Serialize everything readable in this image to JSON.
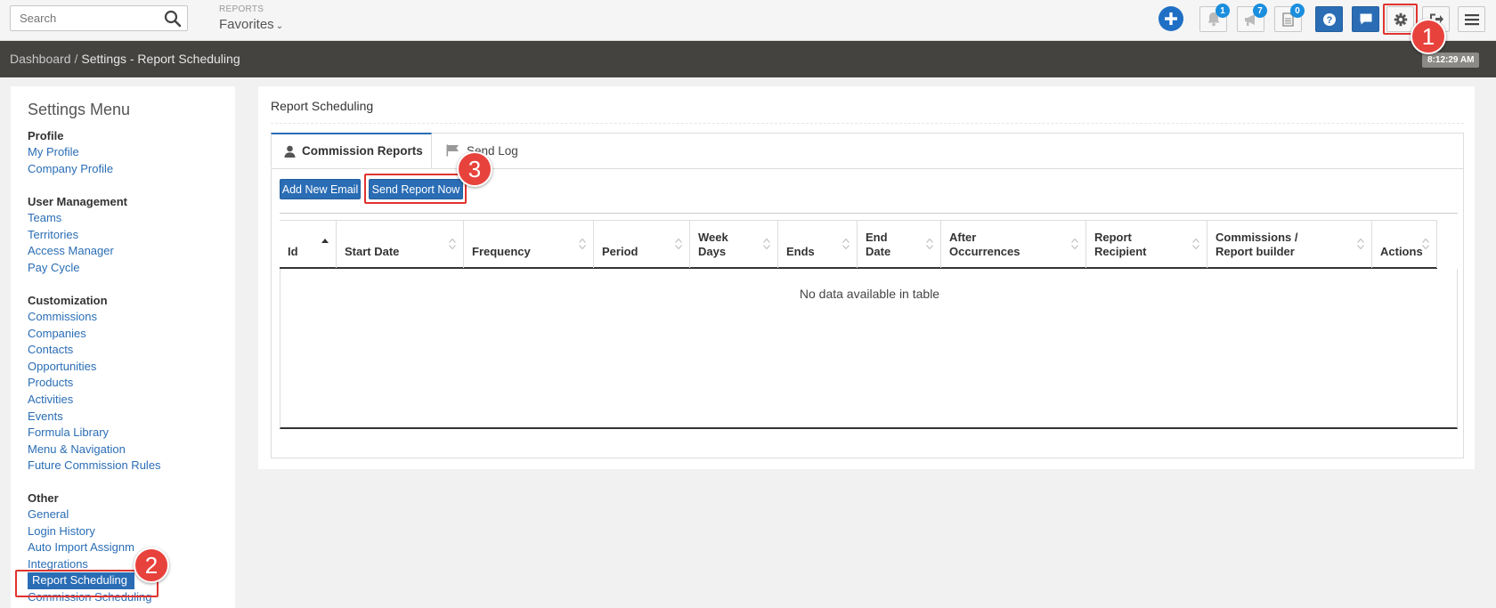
{
  "topbar": {
    "search_placeholder": "Search",
    "reports_label": "REPORTS",
    "favorites_label": "Favorites",
    "notifications_count": "1",
    "announcements_count": "7",
    "documents_count": "0",
    "help_icon": "question-icon",
    "chat_icon": "chat-icon",
    "settings_icon": "gear-icon",
    "logout_icon": "logout-icon",
    "menu_icon": "hamburger-icon"
  },
  "breadcrumb": {
    "home": "Dashboard",
    "separator": "/",
    "current": "Settings - Report Scheduling",
    "clock": "8:12:29 AM"
  },
  "sidebar": {
    "title": "Settings Menu",
    "sections": [
      {
        "heading": "Profile",
        "items": [
          "My Profile",
          "Company Profile"
        ]
      },
      {
        "heading": "User Management",
        "items": [
          "Teams",
          "Territories",
          "Access Manager",
          "Pay Cycle"
        ]
      },
      {
        "heading": "Customization",
        "items": [
          "Commissions",
          "Companies",
          "Contacts",
          "Opportunities",
          "Products",
          "Activities",
          "Events",
          "Formula Library",
          "Menu & Navigation",
          "Future Commission Rules"
        ]
      },
      {
        "heading": "Other",
        "items": [
          "General",
          "Login History",
          "Auto Import Assignm",
          "Integrations",
          "Report Scheduling",
          "Commission Scheduling"
        ]
      }
    ]
  },
  "main": {
    "heading": "Report Scheduling",
    "tabs": [
      {
        "label": "Commission Reports",
        "icon": "user-icon",
        "active": true
      },
      {
        "label": "Send Log",
        "icon": "flag-icon",
        "active": false
      }
    ],
    "buttons": {
      "add_email": "Add New Email",
      "send_now": "Send Report Now"
    },
    "table": {
      "columns": [
        {
          "l1": "",
          "l2": "Id"
        },
        {
          "l1": "",
          "l2": "Start Date"
        },
        {
          "l1": "",
          "l2": "Frequency"
        },
        {
          "l1": "",
          "l2": "Period"
        },
        {
          "l1": "Week",
          "l2": "Days"
        },
        {
          "l1": "",
          "l2": "Ends"
        },
        {
          "l1": "End",
          "l2": "Date"
        },
        {
          "l1": "After",
          "l2": "Occurrences"
        },
        {
          "l1": "Report",
          "l2": "Recipient"
        },
        {
          "l1": "Commissions /",
          "l2": "Report builder"
        },
        {
          "l1": "",
          "l2": "Actions"
        }
      ],
      "empty_message": "No data available in table"
    }
  },
  "annotations": [
    "1",
    "2",
    "3"
  ],
  "colors": {
    "accent": "#2a6db5",
    "annotation": "#e8423d",
    "breadcrumb_bg": "#454340"
  }
}
